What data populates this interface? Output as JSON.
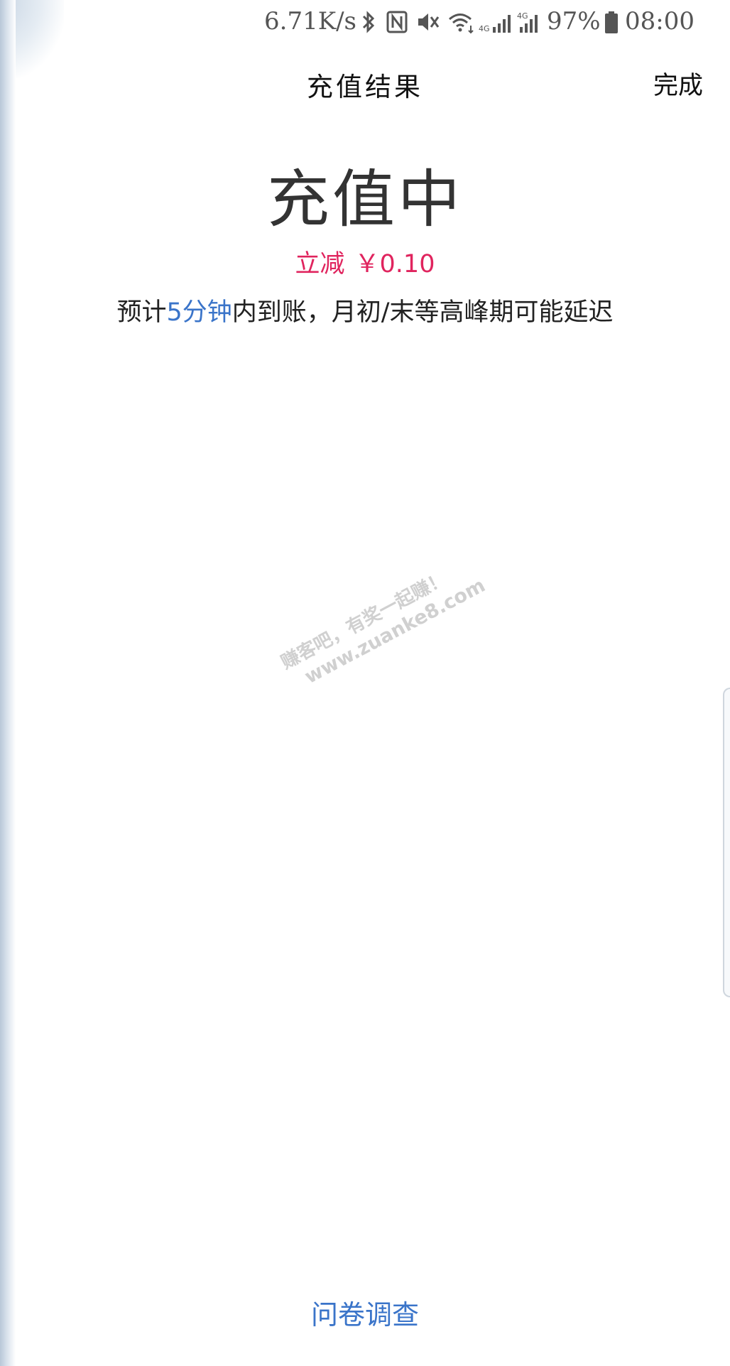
{
  "status_bar": {
    "net_speed": "6.71K/s",
    "battery_percent": "97%",
    "time": "08:00",
    "icons": [
      "bluetooth-icon",
      "nfc-icon",
      "mute-icon",
      "wifi-icon",
      "signal-4g-icon",
      "signal-4g-icon-2",
      "battery-icon"
    ],
    "network_label": "4G"
  },
  "header": {
    "title": "充值结果",
    "done_label": "完成"
  },
  "result": {
    "status": "充值中",
    "discount_label": "立减",
    "discount_amount": "￥0.10",
    "eta_prefix": "预计",
    "eta_highlight": "5分钟",
    "eta_suffix": "内到账，月初/末等高峰期可能延迟"
  },
  "watermark": {
    "line1": "赚客吧，有奖一起赚！",
    "line2": "www.zuanke8.com"
  },
  "footer": {
    "survey_label": "问卷调查"
  },
  "colors": {
    "accent_blue": "#3a74c9",
    "discount_red": "#e0245e"
  }
}
